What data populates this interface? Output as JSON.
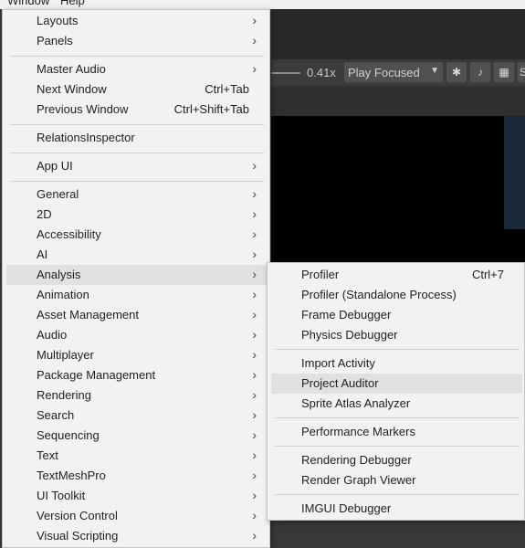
{
  "menubar": {
    "window": "Window",
    "help": "Help"
  },
  "toolbar": {
    "zoom_value": "0.41x",
    "play_mode": "Play Focused",
    "stats_partial": "S"
  },
  "menu": {
    "layouts": "Layouts",
    "panels": "Panels",
    "master_audio": "Master Audio",
    "next_window": "Next Window",
    "next_window_shortcut": "Ctrl+Tab",
    "previous_window": "Previous Window",
    "previous_window_shortcut": "Ctrl+Shift+Tab",
    "relations_inspector": "RelationsInspector",
    "app_ui": "App UI",
    "general": "General",
    "two_d": "2D",
    "accessibility": "Accessibility",
    "ai": "AI",
    "analysis": "Analysis",
    "animation": "Animation",
    "asset_management": "Asset Management",
    "audio": "Audio",
    "multiplayer": "Multiplayer",
    "package_management": "Package Management",
    "rendering": "Rendering",
    "search": "Search",
    "sequencing": "Sequencing",
    "text": "Text",
    "textmeshpro": "TextMeshPro",
    "ui_toolkit": "UI Toolkit",
    "version_control": "Version Control",
    "visual_scripting": "Visual Scripting"
  },
  "submenu": {
    "profiler": "Profiler",
    "profiler_shortcut": "Ctrl+7",
    "profiler_standalone": "Profiler (Standalone Process)",
    "frame_debugger": "Frame Debugger",
    "physics_debugger": "Physics Debugger",
    "import_activity": "Import Activity",
    "project_auditor": "Project Auditor",
    "sprite_atlas_analyzer": "Sprite Atlas Analyzer",
    "performance_markers": "Performance Markers",
    "rendering_debugger": "Rendering Debugger",
    "render_graph_viewer": "Render Graph Viewer",
    "imgui_debugger": "IMGUI Debugger"
  },
  "icons": {
    "submenu_arrow": "chevron-right-icon",
    "dropdown": "caret-down-icon",
    "bug": "bug-icon",
    "audio": "speaker-icon",
    "stats": "keyboard-icon"
  }
}
